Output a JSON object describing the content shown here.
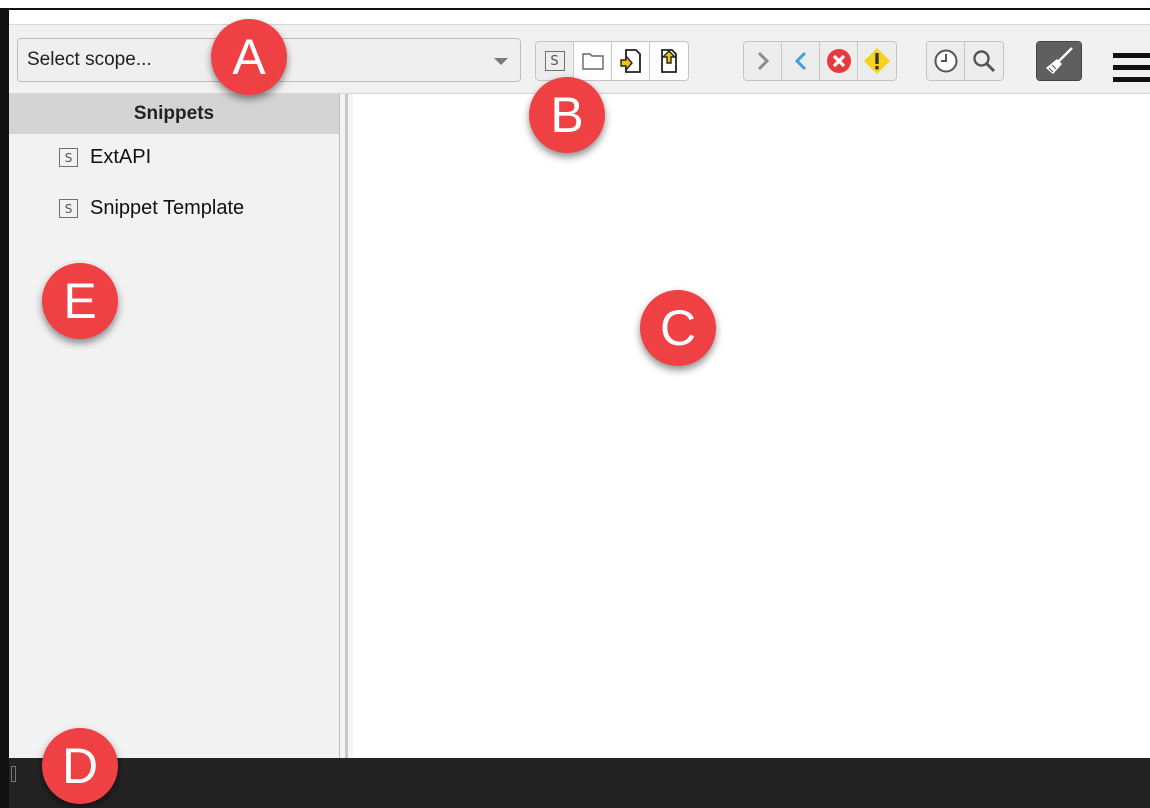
{
  "toolbar": {
    "scope_placeholder": "Select scope..."
  },
  "sidebar": {
    "title": "Snippets",
    "items": [
      {
        "label": "ExtAPI",
        "icon": "S"
      },
      {
        "label": "Snippet Template",
        "icon": "S"
      }
    ]
  },
  "callouts": {
    "a": "A",
    "b": "B",
    "c": "C",
    "d": "D",
    "e": "E"
  },
  "toolbar_icon": "S",
  "colors": {
    "callout": "#ef4044",
    "toolbar": "#f1f1f1",
    "console": "#232323",
    "sidebar_header": "#d4d4d4"
  }
}
